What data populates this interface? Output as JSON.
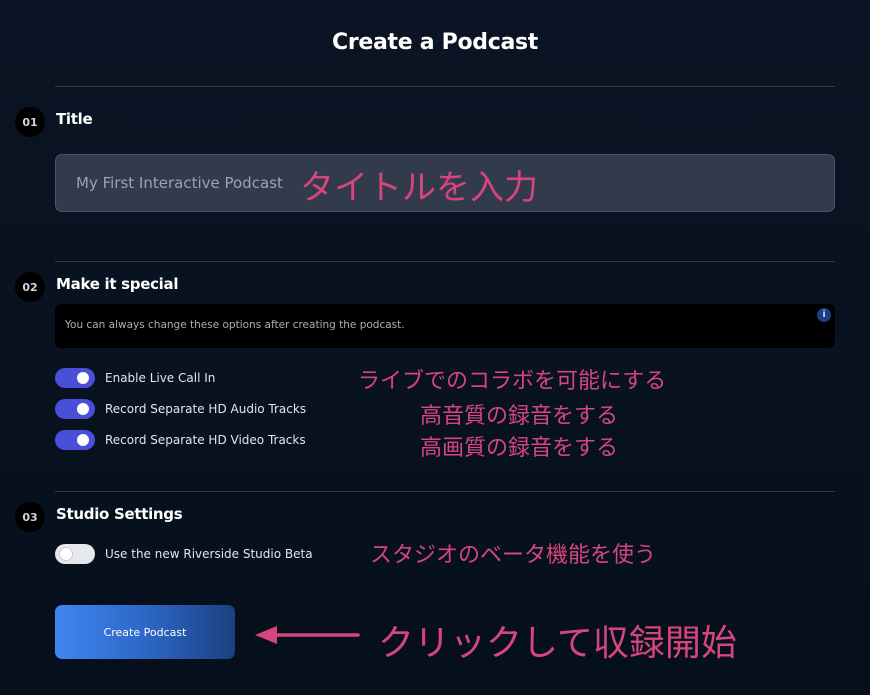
{
  "page": {
    "title": "Create a Podcast"
  },
  "sections": [
    {
      "number": "01",
      "title": "Title"
    },
    {
      "number": "02",
      "title": "Make it special"
    },
    {
      "number": "03",
      "title": "Studio Settings"
    }
  ],
  "title_input": {
    "placeholder": "My First Interactive Podcast",
    "value": ""
  },
  "info_box": {
    "text": "You can always change these options after creating the podcast.",
    "icon": "info-icon",
    "icon_glyph": "i"
  },
  "special_toggles": [
    {
      "label": "Enable Live Call In",
      "on": true
    },
    {
      "label": "Record Separate HD Audio Tracks",
      "on": true
    },
    {
      "label": "Record Separate HD Video Tracks",
      "on": true
    }
  ],
  "studio_toggles": [
    {
      "label": "Use the new Riverside Studio Beta",
      "on": false
    }
  ],
  "create_button": {
    "label": "Create Podcast"
  },
  "annotations": {
    "title": "タイトルを入力",
    "live": "ライブでのコラボを可能にする",
    "audio": "高音質の録音をする",
    "video": "高画質の録音をする",
    "studio": "スタジオのベータ機能を使う",
    "click": "クリックして収録開始"
  },
  "colors": {
    "background": "#07111f",
    "toggle_on": "#4a4ed8",
    "toggle_off": "#e6e8ec",
    "annotation": "#d6457d",
    "button_start": "#3f87f0",
    "button_end": "#1c3f80"
  }
}
